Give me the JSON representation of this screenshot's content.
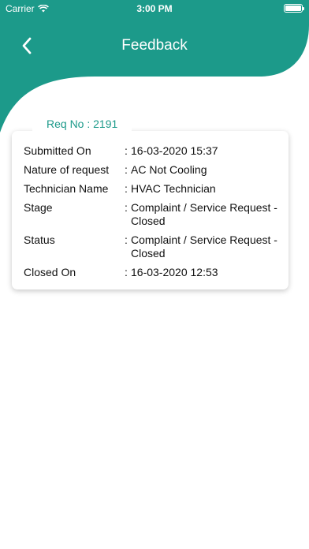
{
  "status_bar": {
    "carrier": "Carrier",
    "time": "3:00 PM"
  },
  "header": {
    "title": "Feedback",
    "back_icon": "chevron-left-icon"
  },
  "colors": {
    "accent": "#1c9a8a",
    "header_bg": "#1c9a8a",
    "text": "#111111"
  },
  "request": {
    "label": "Req No : 2191",
    "rows": [
      {
        "label": "Submitted On",
        "colon": ":",
        "value": "16-03-2020 15:37"
      },
      {
        "label": "Nature of request",
        "colon": ":",
        "value": "AC Not Cooling"
      },
      {
        "label": "Technician Name",
        "colon": ":",
        "value": "HVAC Technician"
      },
      {
        "label": "Stage",
        "colon": ":",
        "value": "Complaint / Service Request - Closed"
      },
      {
        "label": "Status",
        "colon": ":",
        "value": "Complaint / Service Request - Closed"
      },
      {
        "label": "Closed On",
        "colon": ":",
        "value": "16-03-2020 12:53"
      }
    ]
  }
}
